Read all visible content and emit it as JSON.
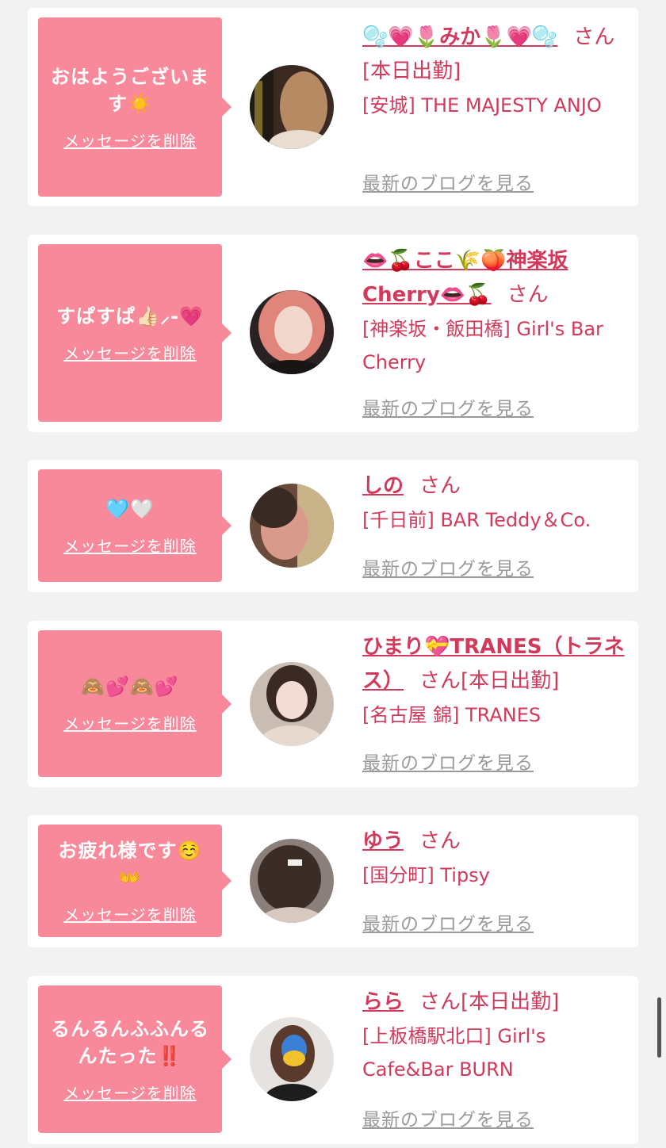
{
  "colors": {
    "accent": "#d23a5c",
    "bubble": "#f7899b",
    "muted": "#9a9a9a"
  },
  "delete_label": "メッセージを削除",
  "blog_label": "最新のブログを見る",
  "san_label": "さん",
  "cards": [
    {
      "message": "おはようございます☀️",
      "name": "🫧💗🌷みか🌷💗🫧",
      "tag": "[本日出勤]",
      "shop": "[安城] THE MAJESTY ANJO"
    },
    {
      "message": "すぱすぱ👍🏻⸝-💗",
      "name": "👄🍒ここ🌾🍑神楽坂Cherry👄🍒",
      "tag": "",
      "shop": "[神楽坂・飯田橋] Girl's Bar Cherry"
    },
    {
      "message": "🩵🤍",
      "name": "しの",
      "tag": "",
      "shop": "[千日前] BAR Teddy＆Co."
    },
    {
      "message": "🙈💕🙈💕",
      "name": "ひまり💝TRANES（トラネス）",
      "tag": "[本日出勤]",
      "shop": "[名古屋 錦] TRANES"
    },
    {
      "message": "お疲れ様です☺️👐",
      "name": "ゆう",
      "tag": "",
      "shop": "[国分町] Tipsy"
    },
    {
      "message": "るんるんふふんるんたった‼️",
      "name": "らら",
      "tag": "[本日出勤]",
      "shop": "[上板橋駅北口] Girl's Cafe&Bar BURN"
    }
  ]
}
